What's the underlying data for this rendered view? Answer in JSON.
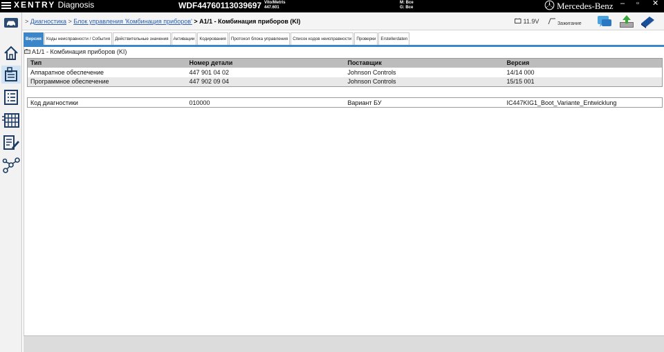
{
  "titlebar": {
    "app_brand": "XENTRY",
    "app_name": "Diagnosis",
    "vin": "WDF44760113039697",
    "model_line1": "Vito/Metris",
    "model_line2": "447.601",
    "mode_line1": "M: Все",
    "mode_line2": "G: Все",
    "logo_text": "Mercedes-Benz",
    "minimize": "–",
    "maximize": "▫",
    "close": "✕"
  },
  "breadcrumb": {
    "sep": ">",
    "item1": "Диагностика",
    "item2": "Блок управления 'Комбинация приборов'",
    "current": "A1/1 - Комбинация приборов (KI)"
  },
  "status": {
    "voltage": "11.9V",
    "ignition": "Зажигание"
  },
  "tabs": [
    {
      "label": "Версия"
    },
    {
      "label": "Коды неисправности / События"
    },
    {
      "label": "Действительные значения"
    },
    {
      "label": "Активации"
    },
    {
      "label": "Кодирования"
    },
    {
      "label": "Протокол блока управления"
    },
    {
      "label": "Список кодов неисправности"
    },
    {
      "label": "Проверки"
    },
    {
      "label": "Erstellerdaten"
    }
  ],
  "section_title": "A1/1 - Комбинация приборов (KI)",
  "table": {
    "headers": [
      "Тип",
      "Номер детали",
      "Поставщик",
      "Версия"
    ],
    "rows": [
      [
        "Аппаратное обеспечение",
        "447 901 04 02",
        "Johnson Controls",
        "14/14 000"
      ],
      [
        "Программное обеспечение",
        "447 902 09 04",
        "Johnson Controls",
        "15/15 001"
      ]
    ]
  },
  "diag_table": {
    "row": [
      "Код диагностики",
      "010000",
      "Вариант БУ",
      "IC447KIG1_Boot_Variante_Entwicklung"
    ]
  },
  "colors": {
    "accent": "#3b86c9",
    "titlebar": "#000000",
    "header_row": "#bcbcbc"
  }
}
